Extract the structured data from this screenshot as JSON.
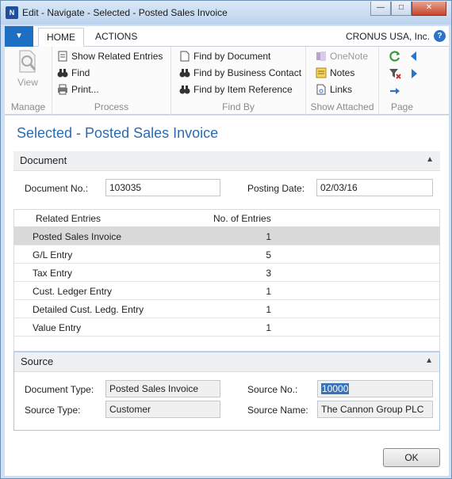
{
  "window": {
    "title": "Edit - Navigate - Selected - Posted Sales Invoice",
    "app_logo_text": "N"
  },
  "ribbon": {
    "tabs": [
      {
        "label": "HOME",
        "active": true
      },
      {
        "label": "ACTIONS",
        "active": false
      }
    ],
    "company": "CRONUS USA, Inc.",
    "help_glyph": "?",
    "groups": {
      "manage": {
        "label": "Manage",
        "view_label": "View"
      },
      "process": {
        "label": "Process",
        "show_related": "Show Related Entries",
        "find": "Find",
        "print": "Print..."
      },
      "find_by": {
        "label": "Find By",
        "by_document": "Find by Document",
        "by_business_contact": "Find by Business Contact",
        "by_item_reference": "Find by Item Reference"
      },
      "show_attached": {
        "label": "Show Attached",
        "onenote": "OneNote",
        "notes": "Notes",
        "links": "Links"
      },
      "page": {
        "label": "Page"
      }
    }
  },
  "page": {
    "title": "Selected - Posted Sales Invoice"
  },
  "document": {
    "header": "Document",
    "document_no_label": "Document No.:",
    "document_no": "103035",
    "posting_date_label": "Posting Date:",
    "posting_date": "02/03/16"
  },
  "grid": {
    "col_related": "Related Entries",
    "col_count": "No. of Entries",
    "rows": [
      {
        "name": "Posted Sales Invoice",
        "count": "1",
        "selected": true
      },
      {
        "name": "G/L Entry",
        "count": "5"
      },
      {
        "name": "Tax Entry",
        "count": "3"
      },
      {
        "name": "Cust. Ledger Entry",
        "count": "1"
      },
      {
        "name": "Detailed Cust. Ledg. Entry",
        "count": "1"
      },
      {
        "name": "Value Entry",
        "count": "1"
      }
    ]
  },
  "source": {
    "header": "Source",
    "document_type_label": "Document Type:",
    "document_type": "Posted Sales Invoice",
    "source_type_label": "Source Type:",
    "source_type": "Customer",
    "source_no_label": "Source No.:",
    "source_no": "10000",
    "source_name_label": "Source Name:",
    "source_name": "The Cannon Group PLC"
  },
  "footer": {
    "ok_label": "OK"
  },
  "colors": {
    "accent": "#2a6bb0",
    "app_menu": "#1d6fc4",
    "selected_row": "#dadada",
    "selection_highlight": "#3b73b9"
  }
}
